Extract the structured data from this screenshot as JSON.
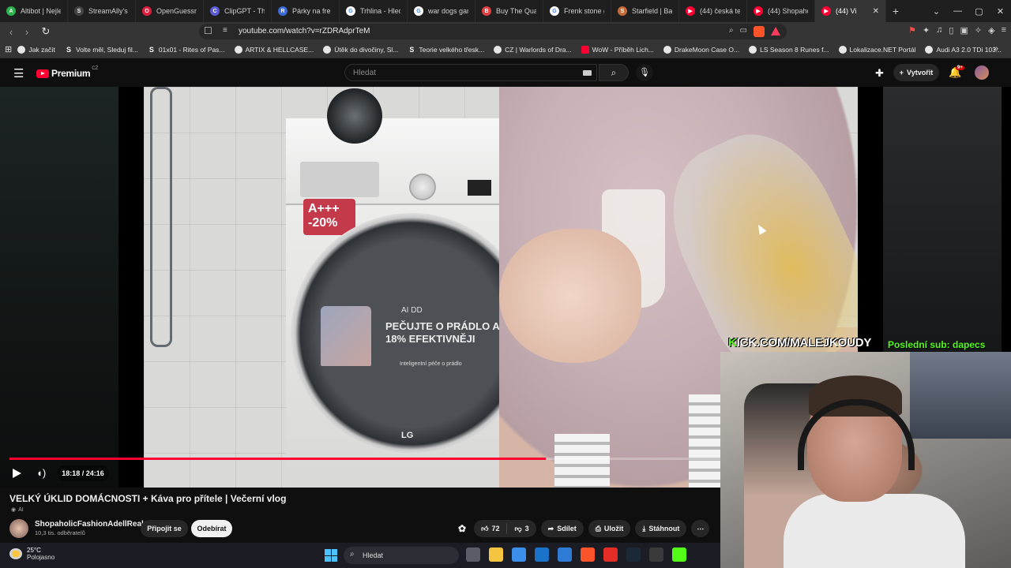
{
  "browser": {
    "tabs": [
      {
        "label": "Altibot | Nejlep",
        "color": "#2bb24c",
        "glyph": "A"
      },
      {
        "label": "StreamAlly's G",
        "color": "#444444",
        "glyph": "S"
      },
      {
        "label": "OpenGuessr -",
        "color": "#e01e3c",
        "glyph": "O"
      },
      {
        "label": "ClipGPT - The",
        "color": "#5b5bd6",
        "glyph": "C"
      },
      {
        "label": "Párky na fre",
        "color": "#3a6bd6",
        "glyph": "R"
      },
      {
        "label": "Trhlina - Hleda",
        "color": "#ffffff",
        "glyph": "G"
      },
      {
        "label": "war dogs gam",
        "color": "#ffffff",
        "glyph": "G"
      },
      {
        "label": "Buy The Quarry",
        "color": "#e04040",
        "glyph": "B"
      },
      {
        "label": "Frenk stone ga",
        "color": "#ffffff",
        "glyph": "G"
      },
      {
        "label": "Starfield | Banc",
        "color": "#c46b3a",
        "glyph": "S"
      },
      {
        "label": "(44) česká tele",
        "color": "#ff0033",
        "glyph": "▶"
      },
      {
        "label": "(44) Shopaholi",
        "color": "#ff0033",
        "glyph": "▶"
      },
      {
        "label": "(44) Vi",
        "color": "#ff0033",
        "glyph": "▶",
        "active": true
      }
    ],
    "url": "youtube.com/watch?v=rZDRAdprTeM",
    "bookmarks": [
      {
        "label": "Jak začít",
        "kind": "globe"
      },
      {
        "label": "Volte měl, Sleduj fil...",
        "kind": "s"
      },
      {
        "label": "01x01 - Rites of Pas...",
        "kind": "s"
      },
      {
        "label": "ARTIX & HELLCASE...",
        "kind": "globe"
      },
      {
        "label": "Útěk do divočiny, Sl...",
        "kind": "globe"
      },
      {
        "label": "Teorie velkého třesk...",
        "kind": "s"
      },
      {
        "label": "CZ | Warlords of Dra...",
        "kind": "globe"
      },
      {
        "label": "WoW - Příběh Lich...",
        "kind": "yt"
      },
      {
        "label": "DrakeMoon Case O...",
        "kind": "globe"
      },
      {
        "label": "LS Season 8 Runes f...",
        "kind": "globe"
      },
      {
        "label": "Lokalizace.NET Portál",
        "kind": "globe"
      },
      {
        "label": "Audi A3 2.0 TDi 103...",
        "kind": "globe"
      }
    ]
  },
  "youtube": {
    "logo_text": "Premium",
    "country": "CZ",
    "search_placeholder": "Hledat",
    "create_label": "Vytvořit",
    "notifications_badge": "9+"
  },
  "player": {
    "current_time": "18:18",
    "duration": "24:16",
    "time_display": "18:18 / 24:16",
    "progress_fraction": 0.754,
    "overlay_kick": "KICK.COM/MALEJKOUDY",
    "overlay_kick_k": "K",
    "overlay_kick_rest": "ICK.COM/MALEJKOUDY",
    "overlay_lastsub": "Poslední sub: dapecs",
    "ad_text_brand": "AI DD",
    "ad_text_main": "PEČUJTE O PRÁDLO AŽ O 18% EFEKTIVNĚJI",
    "ad_text_sub": "Inteligentní péče o prádlo",
    "ad_logo": "LG",
    "energy_label": "A+++ -20%"
  },
  "video": {
    "title": "VELKÝ ÚKLID DOMÁCNOSTI + Káva pro přítele | Večerní vlog",
    "ai_tag": "AI",
    "channel_name": "ShopaholicFashionAdellReal",
    "subscribers": "10,3 tis. odběratelů",
    "join_label": "Připojit se",
    "subscribe_label": "Odebírat",
    "likes": "72",
    "dislikes": "3",
    "share_label": "Sdílet",
    "save_label": "Uložit",
    "download_label": "Stáhnout"
  },
  "taskbar": {
    "temperature": "25°C",
    "condition": "Polojasno",
    "search_label": "Hledat",
    "apps": [
      {
        "name": "task-view-icon",
        "color": "#5a5d68"
      },
      {
        "name": "file-explorer-icon",
        "color": "#f5c542"
      },
      {
        "name": "store-icon",
        "color": "#3b8eea"
      },
      {
        "name": "outlook-icon",
        "color": "#1a73c8"
      },
      {
        "name": "photos-icon",
        "color": "#2d7bd4"
      },
      {
        "name": "brave-icon",
        "color": "#fb542b"
      },
      {
        "name": "youtube-music-icon",
        "color": "#e52d27"
      },
      {
        "name": "steam-icon",
        "color": "#1b2838"
      },
      {
        "name": "obs-icon",
        "color": "#3a3a3a"
      },
      {
        "name": "kick-icon",
        "color": "#53fc18"
      }
    ]
  }
}
